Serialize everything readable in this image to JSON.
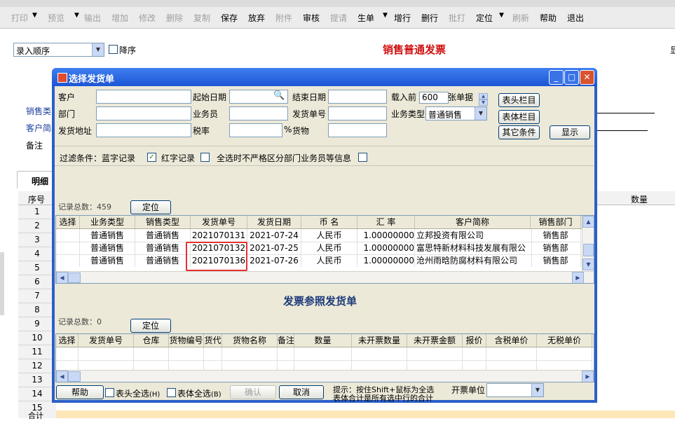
{
  "toolbar": {
    "items": [
      {
        "label": "打印",
        "enabled": false
      },
      {
        "label": "预览",
        "enabled": false
      },
      {
        "label": "输出",
        "enabled": false
      },
      {
        "label": "增加",
        "enabled": false
      },
      {
        "label": "修改",
        "enabled": false
      },
      {
        "label": "删除",
        "enabled": false
      },
      {
        "label": "复制",
        "enabled": false
      },
      {
        "label": "保存",
        "enabled": true
      },
      {
        "label": "放弃",
        "enabled": true
      },
      {
        "label": "附件",
        "enabled": false
      },
      {
        "label": "审核",
        "enabled": true
      },
      {
        "label": "提请",
        "enabled": false
      },
      {
        "label": "生单",
        "enabled": true
      },
      {
        "label": "增行",
        "enabled": true
      },
      {
        "label": "删行",
        "enabled": true
      },
      {
        "label": "批打",
        "enabled": false
      },
      {
        "label": "定位",
        "enabled": true
      },
      {
        "label": "刷新",
        "enabled": false
      },
      {
        "label": "帮助",
        "enabled": true
      },
      {
        "label": "退出",
        "enabled": true
      }
    ]
  },
  "background": {
    "sort_select": "录入顺序",
    "desc_label": "降序",
    "form_title": "销售普通发票",
    "right_edge_text": "显",
    "side_labels": {
      "sales_type": "销售类",
      "customer_short": "客户简称",
      "remark": "备注"
    },
    "tab_label": "明细",
    "row_header": "序号",
    "row_numbers": [
      "1",
      "2",
      "3",
      "4",
      "5",
      "6",
      "7",
      "8",
      "9",
      "10",
      "11",
      "12",
      "13",
      "14",
      "15"
    ],
    "total_label": "合计",
    "qty_header": "数量"
  },
  "dialog": {
    "title": "选择发货单",
    "filters": {
      "customer_label": "客户",
      "start_date_label": "起始日期",
      "end_date_label": "结束日期",
      "load_prefix": "载入前",
      "load_count": "600",
      "load_suffix": "张单据",
      "dept_label": "部门",
      "salesman_label": "业务员",
      "ship_no_label": "发货单号",
      "biz_type_label": "业务类型",
      "biz_type_value": "普通销售",
      "address_label": "发货地址",
      "tax_label": "税率",
      "percent": "%",
      "goods_label": "货物"
    },
    "buttons": {
      "header_cols": "表头栏目",
      "body_cols": "表体栏目",
      "other_conditions": "其它条件",
      "show": "显示"
    },
    "filter_line": {
      "text": "过滤条件：蓝字记录",
      "red_label": "红字记录",
      "nonstrict_label": "全选时不严格区分部门业务员等信息",
      "blue_checked": "✓"
    },
    "upper": {
      "record_count": "记录总数：459",
      "locate": "定位",
      "columns": [
        "选择",
        "业务类型",
        "销售类型",
        "发货单号",
        "发货日期",
        "币 名",
        "汇 率",
        "客户简称",
        "销售部门"
      ],
      "rows": [
        [
          "",
          "普通销售",
          "普通销售",
          "2021070131",
          "2021-07-24",
          "人民币",
          "1.00000000",
          "立邦投资有限公司",
          "销售部"
        ],
        [
          "",
          "普通销售",
          "普通销售",
          "2021070132",
          "2021-07-25",
          "人民币",
          "1.00000000",
          "富思特新材料科技发展有限公",
          "销售部"
        ],
        [
          "",
          "普通销售",
          "普通销售",
          "2021070136",
          "2021-07-26",
          "人民币",
          "1.00000000",
          "沧州雨晗防腐材料有限公司",
          "销售部"
        ]
      ]
    },
    "lower": {
      "title": "发票参照发货单",
      "record_count": "记录总数：0",
      "locate": "定位",
      "columns": [
        "选择",
        "发货单号",
        "仓库",
        "货物编号",
        "货代",
        "货物名称",
        "备注",
        "数量",
        "未开票数量",
        "未开票金额",
        "报价",
        "含税单价",
        "无税单价"
      ]
    },
    "footer": {
      "help": "帮助",
      "header_all": "表头全选",
      "header_all_key": "(H)",
      "body_all": "表体全选",
      "body_all_key": "(B)",
      "confirm": "确认",
      "cancel": "取消",
      "hint_line1": "提示：按住Shift+鼠标为全选",
      "hint_line2": "表体合计是所有选中行的合计",
      "invoice_unit_label": "开票单位"
    }
  }
}
